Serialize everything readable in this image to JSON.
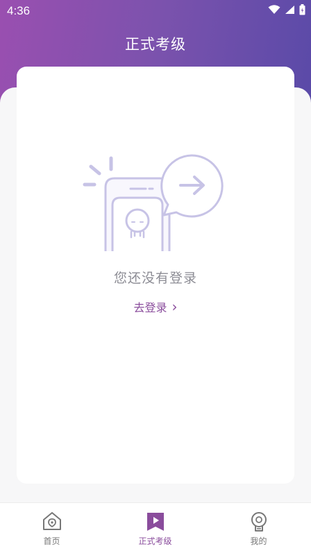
{
  "status_bar": {
    "time": "4:36",
    "icons": [
      "wifi-icon",
      "signal-icon",
      "battery-icon"
    ]
  },
  "header": {
    "title": "正式考级"
  },
  "empty_state": {
    "illustration": "phone-login-illustration",
    "message": "您还没有登录",
    "login_link": "去登录",
    "login_chevron": "›"
  },
  "tab_bar": {
    "tabs": [
      {
        "label": "首页",
        "icon": "home-icon",
        "active": false
      },
      {
        "label": "正式考级",
        "icon": "exam-bookmark-icon",
        "active": true
      },
      {
        "label": "我的",
        "icon": "profile-icon",
        "active": false
      }
    ]
  },
  "colors": {
    "accent": "#8a4c9c",
    "header_start": "#9a4fb0",
    "header_end": "#5a4aa8",
    "illustration_stroke": "#c7c3e6"
  }
}
